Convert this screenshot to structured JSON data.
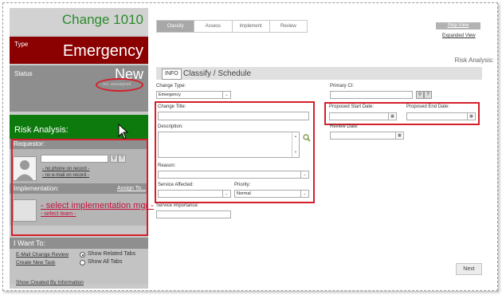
{
  "left_panel": {
    "change_title": "Change 1010",
    "type_label": "Type",
    "type_value": "Emergency",
    "status_label": "Status",
    "status_value": "New",
    "status_circled_text": "rec. unassigned",
    "risk_label": "Risk Analysis:",
    "requestor": {
      "heading": "Requestor:",
      "no_phone": "- no phone on record -",
      "no_email": "- no e-mail on record -"
    },
    "implementation": {
      "heading": "Implementation:",
      "assign_link": "Assign To...",
      "select_mgr": "- select implementation mgr -",
      "select_team": "- select team -"
    },
    "i_want_to": {
      "heading": "I Want To:",
      "links": [
        "E-Mail Change Review",
        "Create New Task",
        "Show Created By Information"
      ],
      "radios": [
        {
          "label": "Show Related Tabs",
          "checked": true
        },
        {
          "label": "Show All Tabs",
          "checked": false
        }
      ]
    }
  },
  "tabs": [
    "Classify",
    "Assess",
    "Implement",
    "Review"
  ],
  "active_tab": "Classify",
  "view_links": {
    "step_view": "Step View",
    "expanded_view": "Expanded View"
  },
  "right_risk_label": "Risk Analysis:",
  "form": {
    "info_badge": "INFO",
    "title": "Classify / Schedule",
    "change_type_label": "Change Type:",
    "change_type_value": "Emergency",
    "primary_ci_label": "Primary CI:",
    "change_title_label": "Change Title:",
    "description_label": "Description:",
    "reason_label": "Reason:",
    "service_affected_label": "Service Affected:",
    "priority_label": "Priority:",
    "priority_value": "Normal",
    "service_importance_label": "Service Importance:",
    "proposed_start_label": "Proposed Start Date:",
    "proposed_end_label": "Proposed End Date:",
    "review_date_label": "Review Date:"
  },
  "buttons": {
    "next": "Next"
  },
  "colors": {
    "type_bg": "#8b0000",
    "risk_bg": "#0d7a0d",
    "title_green": "#2b8a2b",
    "highlight_red": "#d41f2b",
    "link_red": "#c0143c"
  }
}
